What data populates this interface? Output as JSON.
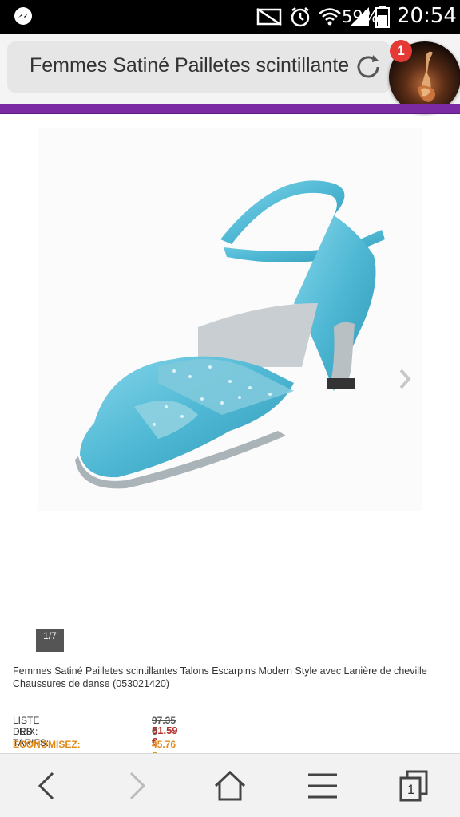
{
  "status_bar": {
    "battery_percent": "59%",
    "time": "20:54",
    "icons": [
      "messenger-icon",
      "mute-icon",
      "alarm-icon",
      "wifi-icon",
      "signal-icon",
      "battery-icon"
    ]
  },
  "browser": {
    "page_title": "Femmes Satiné Pailletes scintillante",
    "notification_count": "1"
  },
  "product": {
    "image_counter": "1/7",
    "description": "Femmes Satiné Pailletes scintillantes Talons Escarpins Modern Style avec Lanière de cheville Chaussures de danse (053021420)",
    "list_price_label": "LISTE DES TARIFS:",
    "list_price": "97.35 €",
    "price_label": "PRIX:",
    "price": "51.59 €",
    "savings_label": "ECONOMISEZ:",
    "savings": "45.76 €",
    "colors": {
      "price": "#b0302a",
      "savings": "#e08a1a",
      "shoe": "#5fc3dc"
    }
  },
  "nav": {
    "tabs_count": "1",
    "icons": [
      "back-icon",
      "forward-icon",
      "home-icon",
      "menu-icon",
      "tabs-icon"
    ]
  }
}
